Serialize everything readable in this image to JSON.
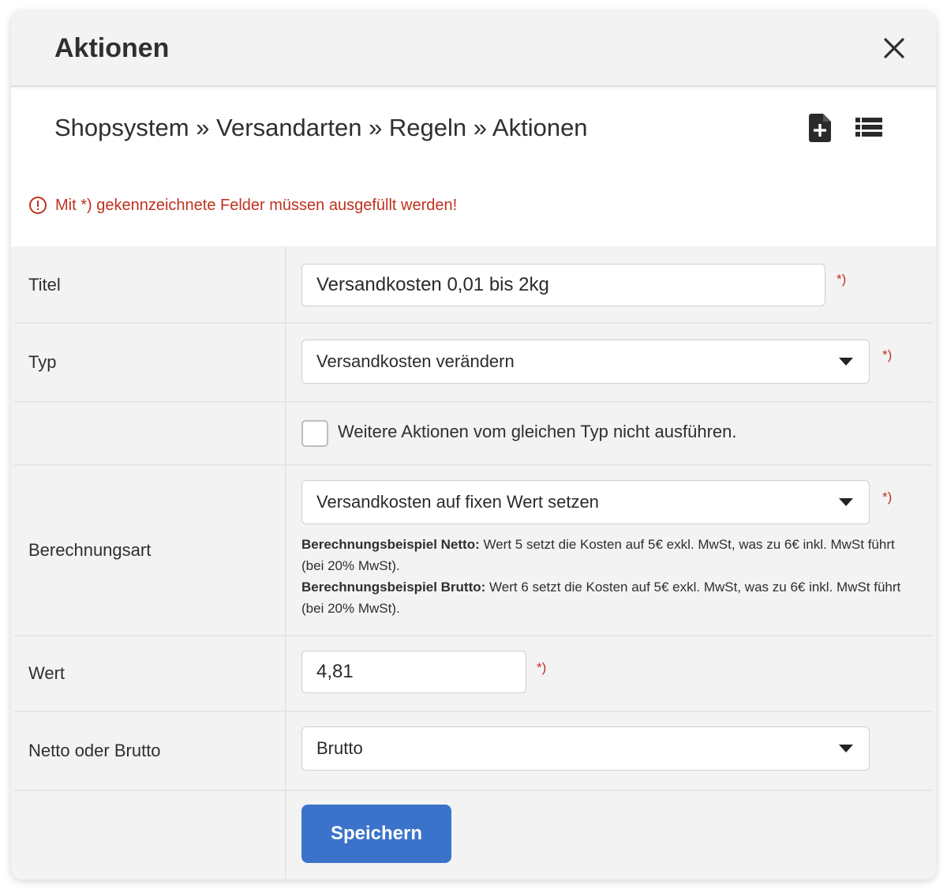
{
  "dialog": {
    "title": "Aktionen",
    "close_icon": "close-icon"
  },
  "breadcrumb": "Shopsystem » Versandarten » Regeln » Aktionen",
  "toolbar": {
    "new_icon": "file-plus-icon",
    "list_icon": "list-icon"
  },
  "notice": {
    "icon": "alert-circle-icon",
    "text": "Mit *) gekennzeichnete Felder müssen ausgefüllt werden!",
    "color": "#c0311f"
  },
  "required_marker": "*)",
  "form": {
    "titel": {
      "label": "Titel",
      "value": "Versandkosten 0,01 bis 2kg"
    },
    "typ": {
      "label": "Typ",
      "value": "Versandkosten verändern"
    },
    "checkbox": {
      "label": "Weitere Aktionen vom gleichen Typ nicht ausführen.",
      "checked": false
    },
    "berechnungsart": {
      "label": "Berechnungsart",
      "value": "Versandkosten auf fixen Wert setzen",
      "help_netto_title": "Berechnungsbeispiel Netto:",
      "help_netto_text": " Wert 5 setzt die Kosten auf 5€ exkl. MwSt, was zu 6€ inkl. MwSt führt (bei 20% MwSt).",
      "help_brutto_title": "Berechnungsbeispiel Brutto:",
      "help_brutto_text": " Wert 6 setzt die Kosten auf 5€ exkl. MwSt, was zu 6€ inkl. MwSt führt (bei 20% MwSt)."
    },
    "wert": {
      "label": "Wert",
      "value": "4,81"
    },
    "netto_brutto": {
      "label": "Netto oder Brutto",
      "value": "Brutto"
    }
  },
  "save_button": "Speichern",
  "colors": {
    "accent": "#3b73cb",
    "required": "#c0311f",
    "background": "#f3f3f3"
  }
}
